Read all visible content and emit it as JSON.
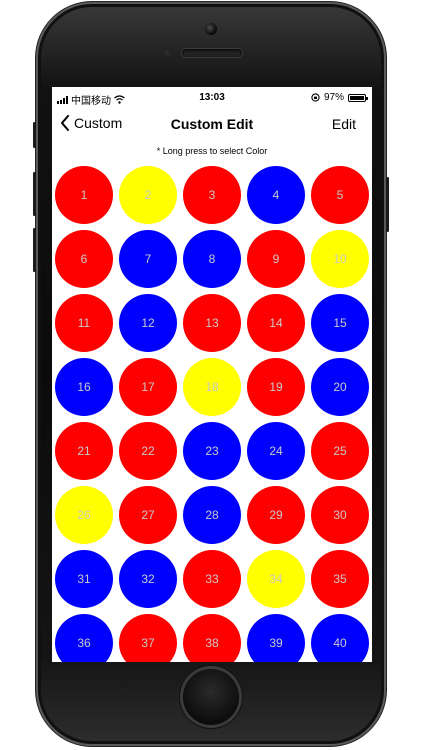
{
  "status": {
    "carrier": "中国移动",
    "time": "13:03",
    "battery": "97%",
    "battery_level": 0.97
  },
  "nav": {
    "back_label": "Custom",
    "title": "Custom Edit",
    "edit_label": "Edit"
  },
  "hint": "* Long press to select Color",
  "colors": {
    "red": "#ff0000",
    "blue": "#0000ff",
    "yellow": "#ffff00"
  },
  "cells": [
    {
      "n": "1",
      "c": "red"
    },
    {
      "n": "2",
      "c": "yellow"
    },
    {
      "n": "3",
      "c": "red"
    },
    {
      "n": "4",
      "c": "blue"
    },
    {
      "n": "5",
      "c": "red"
    },
    {
      "n": "6",
      "c": "red"
    },
    {
      "n": "7",
      "c": "blue"
    },
    {
      "n": "8",
      "c": "blue"
    },
    {
      "n": "9",
      "c": "red"
    },
    {
      "n": "10",
      "c": "yellow"
    },
    {
      "n": "11",
      "c": "red"
    },
    {
      "n": "12",
      "c": "blue"
    },
    {
      "n": "13",
      "c": "red"
    },
    {
      "n": "14",
      "c": "red"
    },
    {
      "n": "15",
      "c": "blue"
    },
    {
      "n": "16",
      "c": "blue"
    },
    {
      "n": "17",
      "c": "red"
    },
    {
      "n": "18",
      "c": "yellow"
    },
    {
      "n": "19",
      "c": "red"
    },
    {
      "n": "20",
      "c": "blue"
    },
    {
      "n": "21",
      "c": "red"
    },
    {
      "n": "22",
      "c": "red"
    },
    {
      "n": "23",
      "c": "blue"
    },
    {
      "n": "24",
      "c": "blue"
    },
    {
      "n": "25",
      "c": "red"
    },
    {
      "n": "26",
      "c": "yellow"
    },
    {
      "n": "27",
      "c": "red"
    },
    {
      "n": "28",
      "c": "blue"
    },
    {
      "n": "29",
      "c": "red"
    },
    {
      "n": "30",
      "c": "red"
    },
    {
      "n": "31",
      "c": "blue"
    },
    {
      "n": "32",
      "c": "blue"
    },
    {
      "n": "33",
      "c": "red"
    },
    {
      "n": "34",
      "c": "yellow"
    },
    {
      "n": "35",
      "c": "red"
    },
    {
      "n": "36",
      "c": "blue"
    },
    {
      "n": "37",
      "c": "red"
    },
    {
      "n": "38",
      "c": "red"
    },
    {
      "n": "39",
      "c": "blue"
    },
    {
      "n": "40",
      "c": "blue"
    }
  ]
}
